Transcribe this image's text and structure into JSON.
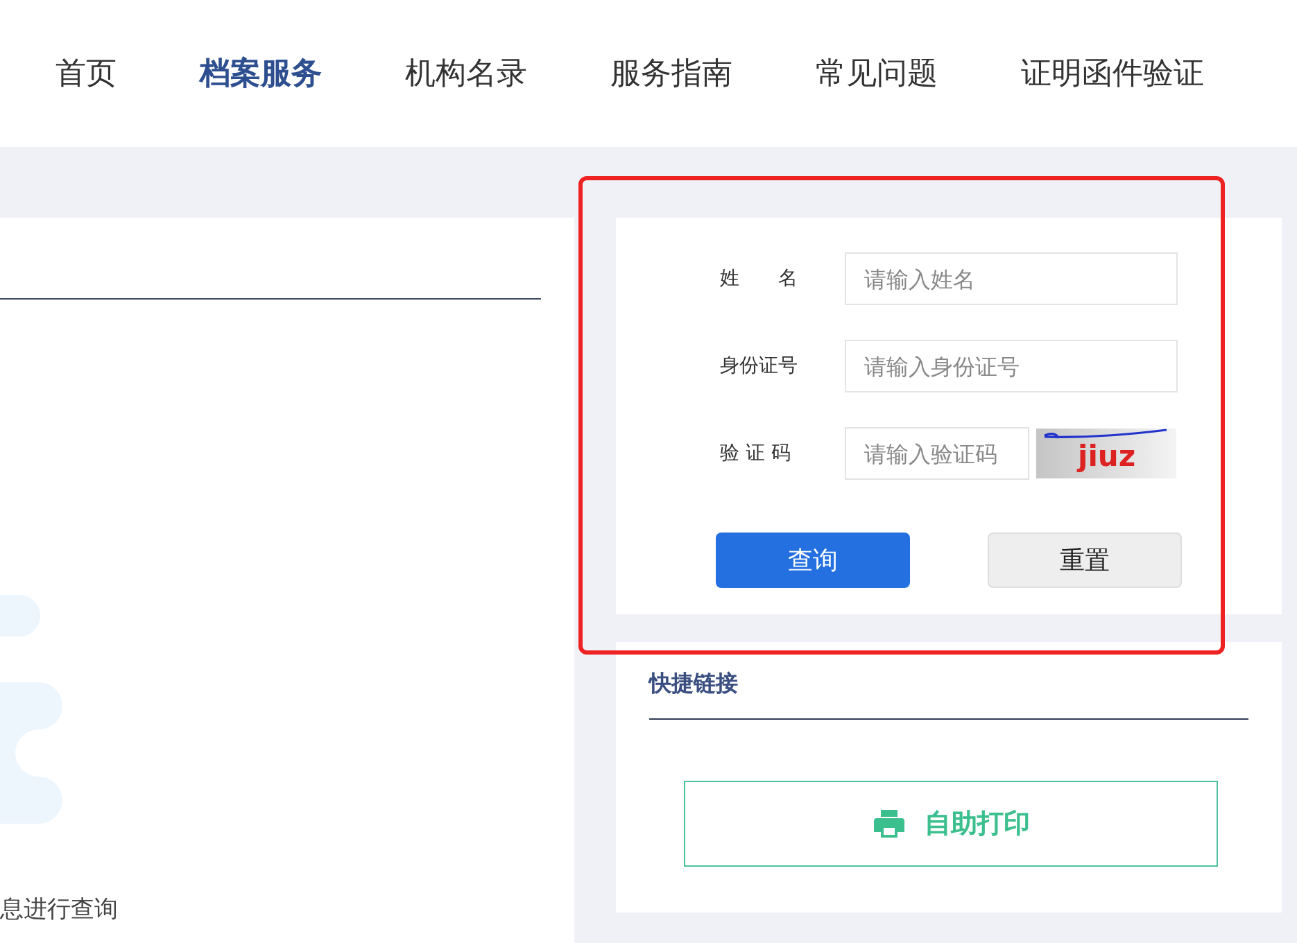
{
  "nav": {
    "items": [
      {
        "label": "首页",
        "selected": false
      },
      {
        "label": "档案服务",
        "selected": true
      },
      {
        "label": "机构名录",
        "selected": false
      },
      {
        "label": "服务指南",
        "selected": false
      },
      {
        "label": "常见问题",
        "selected": false
      },
      {
        "label": "证明函件验证",
        "selected": false
      }
    ]
  },
  "left_panel": {
    "text": "息进行查询"
  },
  "query_form": {
    "fields": [
      {
        "label": "姓　　名",
        "placeholder": "请输入姓名",
        "kind": "text"
      },
      {
        "label": "身份证号",
        "placeholder": "请输入身份证号",
        "kind": "text"
      },
      {
        "label": "验 证 码",
        "placeholder": "请输入验证码",
        "kind": "captcha"
      }
    ],
    "captcha": {
      "text": "jiuz"
    },
    "buttons": [
      {
        "label": "查询",
        "kind": "primary"
      },
      {
        "label": "重置",
        "kind": "secondary"
      }
    ]
  },
  "quick_links": {
    "title": "快捷链接",
    "links": [
      {
        "label": "自助打印"
      }
    ]
  },
  "annotation": {
    "highlighted": true
  }
}
